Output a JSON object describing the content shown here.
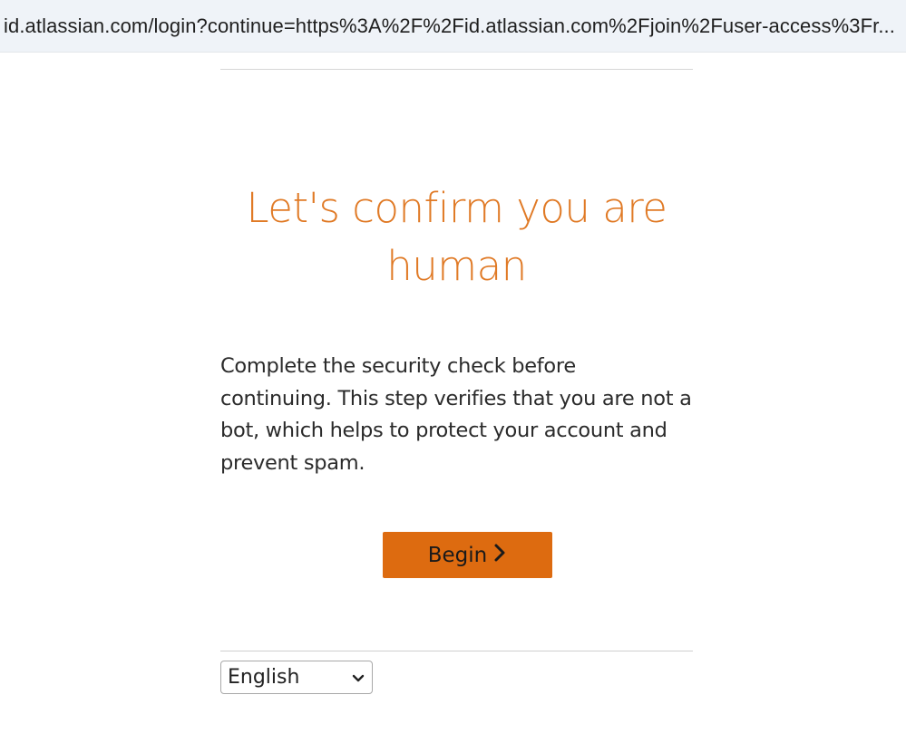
{
  "browser": {
    "url": "id.atlassian.com/login?continue=https%3A%2F%2Fid.atlassian.com%2Fjoin%2Fuser-access%3Fr..."
  },
  "page": {
    "title": "Let's confirm you are human",
    "description": "Complete the security check before continuing. This step verifies that you are not a bot, which helps to protect your account and prevent spam.",
    "begin_label": "Begin",
    "language_selected": "English"
  },
  "colors": {
    "title": "#e07a26",
    "button": "#dd6b10"
  },
  "icons": {
    "begin_icon": "chevron-right-icon",
    "select_icon": "chevron-down-icon"
  }
}
